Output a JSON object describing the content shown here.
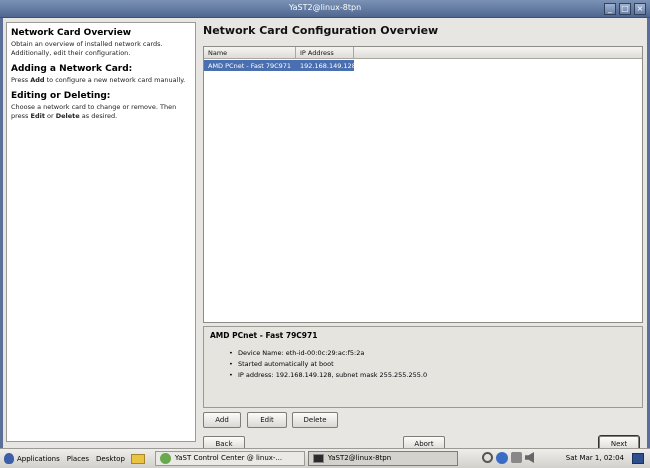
{
  "window": {
    "title": "YaST2@linux-8tpn",
    "buttons": [
      "_",
      "□",
      "×"
    ]
  },
  "help": {
    "sections": [
      {
        "heading": "Network Card Overview",
        "body": "Obtain an overview of installed network cards. Additionally, edit their configuration."
      },
      {
        "heading": "Adding a Network Card:",
        "pre": "Press ",
        "bold1": "Add",
        "post": " to configure a new network card manually."
      },
      {
        "heading": "Editing or Deleting:",
        "pre": "Choose a network card to change or remove. Then press ",
        "bold1": "Edit",
        "mid": " or ",
        "bold2": "Delete",
        "post": " as desired."
      }
    ]
  },
  "main": {
    "title": "Network Card Configuration Overview",
    "table": {
      "columns": [
        "Name",
        "IP Address"
      ],
      "rows": [
        {
          "name": "AMD PCnet - Fast 79C971",
          "ip": "192.168.149.128",
          "selected": true
        }
      ]
    },
    "details": {
      "header": "AMD PCnet - Fast 79C971",
      "items": [
        "Device Name: eth-id-00:0c:29:ac:f5:2a",
        "Started automatically at boot",
        "IP address: 192.168.149.128, subnet mask 255.255.255.0"
      ]
    },
    "buttons": {
      "add": "Add",
      "edit": "Edit",
      "delete": "Delete",
      "back": "Back",
      "abort": "Abort",
      "next": "Next"
    }
  },
  "taskbar": {
    "menus": [
      "Applications",
      "Places",
      "Desktop"
    ],
    "tasks": [
      "YaST Control Center @ linux-...",
      "YaST2@linux-8tpn"
    ],
    "clock": "Sat Mar 1, 02:04"
  }
}
